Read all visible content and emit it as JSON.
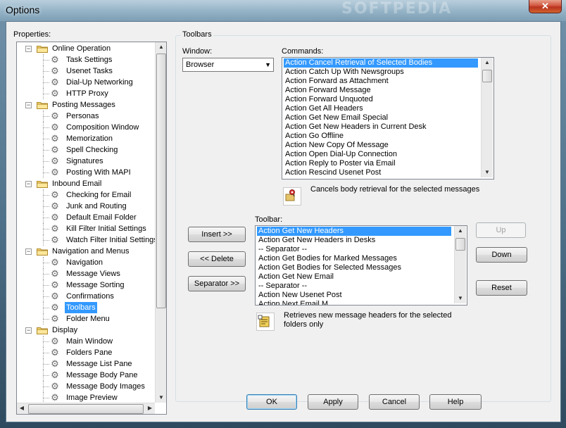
{
  "window": {
    "title": "Options",
    "watermark": "SOFTPEDIA",
    "close_glyph": "✕"
  },
  "properties": {
    "label": "Properties:",
    "tree": [
      {
        "text": "Online Operation",
        "level": 0,
        "type": "folder"
      },
      {
        "text": "Task Settings",
        "level": 1,
        "type": "gear"
      },
      {
        "text": "Usenet Tasks",
        "level": 1,
        "type": "gear"
      },
      {
        "text": "Dial-Up Networking",
        "level": 1,
        "type": "gear"
      },
      {
        "text": "HTTP Proxy",
        "level": 1,
        "type": "gear"
      },
      {
        "text": "Posting Messages",
        "level": 0,
        "type": "folder"
      },
      {
        "text": "Personas",
        "level": 1,
        "type": "gear"
      },
      {
        "text": "Composition Window",
        "level": 1,
        "type": "gear"
      },
      {
        "text": "Memorization",
        "level": 1,
        "type": "gear"
      },
      {
        "text": "Spell Checking",
        "level": 1,
        "type": "gear"
      },
      {
        "text": "Signatures",
        "level": 1,
        "type": "gear"
      },
      {
        "text": "Posting With MAPI",
        "level": 1,
        "type": "gear"
      },
      {
        "text": "Inbound Email",
        "level": 0,
        "type": "folder"
      },
      {
        "text": "Checking for Email",
        "level": 1,
        "type": "gear"
      },
      {
        "text": "Junk and Routing",
        "level": 1,
        "type": "gear"
      },
      {
        "text": "Default Email Folder",
        "level": 1,
        "type": "gear"
      },
      {
        "text": "Kill Filter Initial Settings",
        "level": 1,
        "type": "gear"
      },
      {
        "text": "Watch Filter Initial Settings",
        "level": 1,
        "type": "gear"
      },
      {
        "text": "Navigation and Menus",
        "level": 0,
        "type": "folder"
      },
      {
        "text": "Navigation",
        "level": 1,
        "type": "gear"
      },
      {
        "text": "Message Views",
        "level": 1,
        "type": "gear"
      },
      {
        "text": "Message Sorting",
        "level": 1,
        "type": "gear"
      },
      {
        "text": "Confirmations",
        "level": 1,
        "type": "gear"
      },
      {
        "text": "Toolbars",
        "level": 1,
        "type": "gear",
        "selected": true
      },
      {
        "text": "Folder Menu",
        "level": 1,
        "type": "gear"
      },
      {
        "text": "Display",
        "level": 0,
        "type": "folder"
      },
      {
        "text": "Main Window",
        "level": 1,
        "type": "gear"
      },
      {
        "text": "Folders Pane",
        "level": 1,
        "type": "gear"
      },
      {
        "text": "Message List Pane",
        "level": 1,
        "type": "gear"
      },
      {
        "text": "Message Body Pane",
        "level": 1,
        "type": "gear"
      },
      {
        "text": "Message Body Images",
        "level": 1,
        "type": "gear"
      },
      {
        "text": "Image Preview",
        "level": 1,
        "type": "gear"
      }
    ]
  },
  "toolbars": {
    "group_title": "Toolbars",
    "window_label": "Window:",
    "window_value": "Browser",
    "commands_label": "Commands:",
    "commands": [
      "Action Cancel Retrieval of Selected Bodies",
      "Action Catch Up With Newsgroups",
      "Action Forward as Attachment",
      "Action Forward Message",
      "Action Forward Unquoted",
      "Action Get All Headers",
      "Action Get New Email Special",
      "Action Get New Headers in Current Desk",
      "Action Go Offline",
      "Action New Copy Of Message",
      "Action Open Dial-Up Connection",
      "Action Reply to Poster via Email",
      "Action Rescind Usenet Post"
    ],
    "commands_selected": 0,
    "command_description": "Cancels body retrieval for the selected messages",
    "toolbar_label": "Toolbar:",
    "toolbar_items": [
      "Action Get New Headers",
      "Action Get New Headers in Desks",
      "-- Separator --",
      "Action Get Bodies for Marked Messages",
      "Action Get Bodies for Selected Messages",
      "Action Get New Email",
      "-- Separator --",
      "Action New Usenet Post",
      "Action Next Email M..."
    ],
    "toolbar_selected": 0,
    "toolbar_description": "Retrieves new message headers for the selected folders only",
    "insert_label": "Insert >>",
    "delete_label": "<< Delete",
    "separator_label": "Separator >>",
    "up_label": "Up",
    "down_label": "Down",
    "reset_label": "Reset"
  },
  "footer": {
    "ok_label": "OK",
    "apply_label": "Apply",
    "cancel_label": "Cancel",
    "help_label": "Help"
  },
  "colors": {
    "selection": "#3399ff",
    "dialog_bg": "#f0f0f0",
    "list_border": "#828790"
  }
}
